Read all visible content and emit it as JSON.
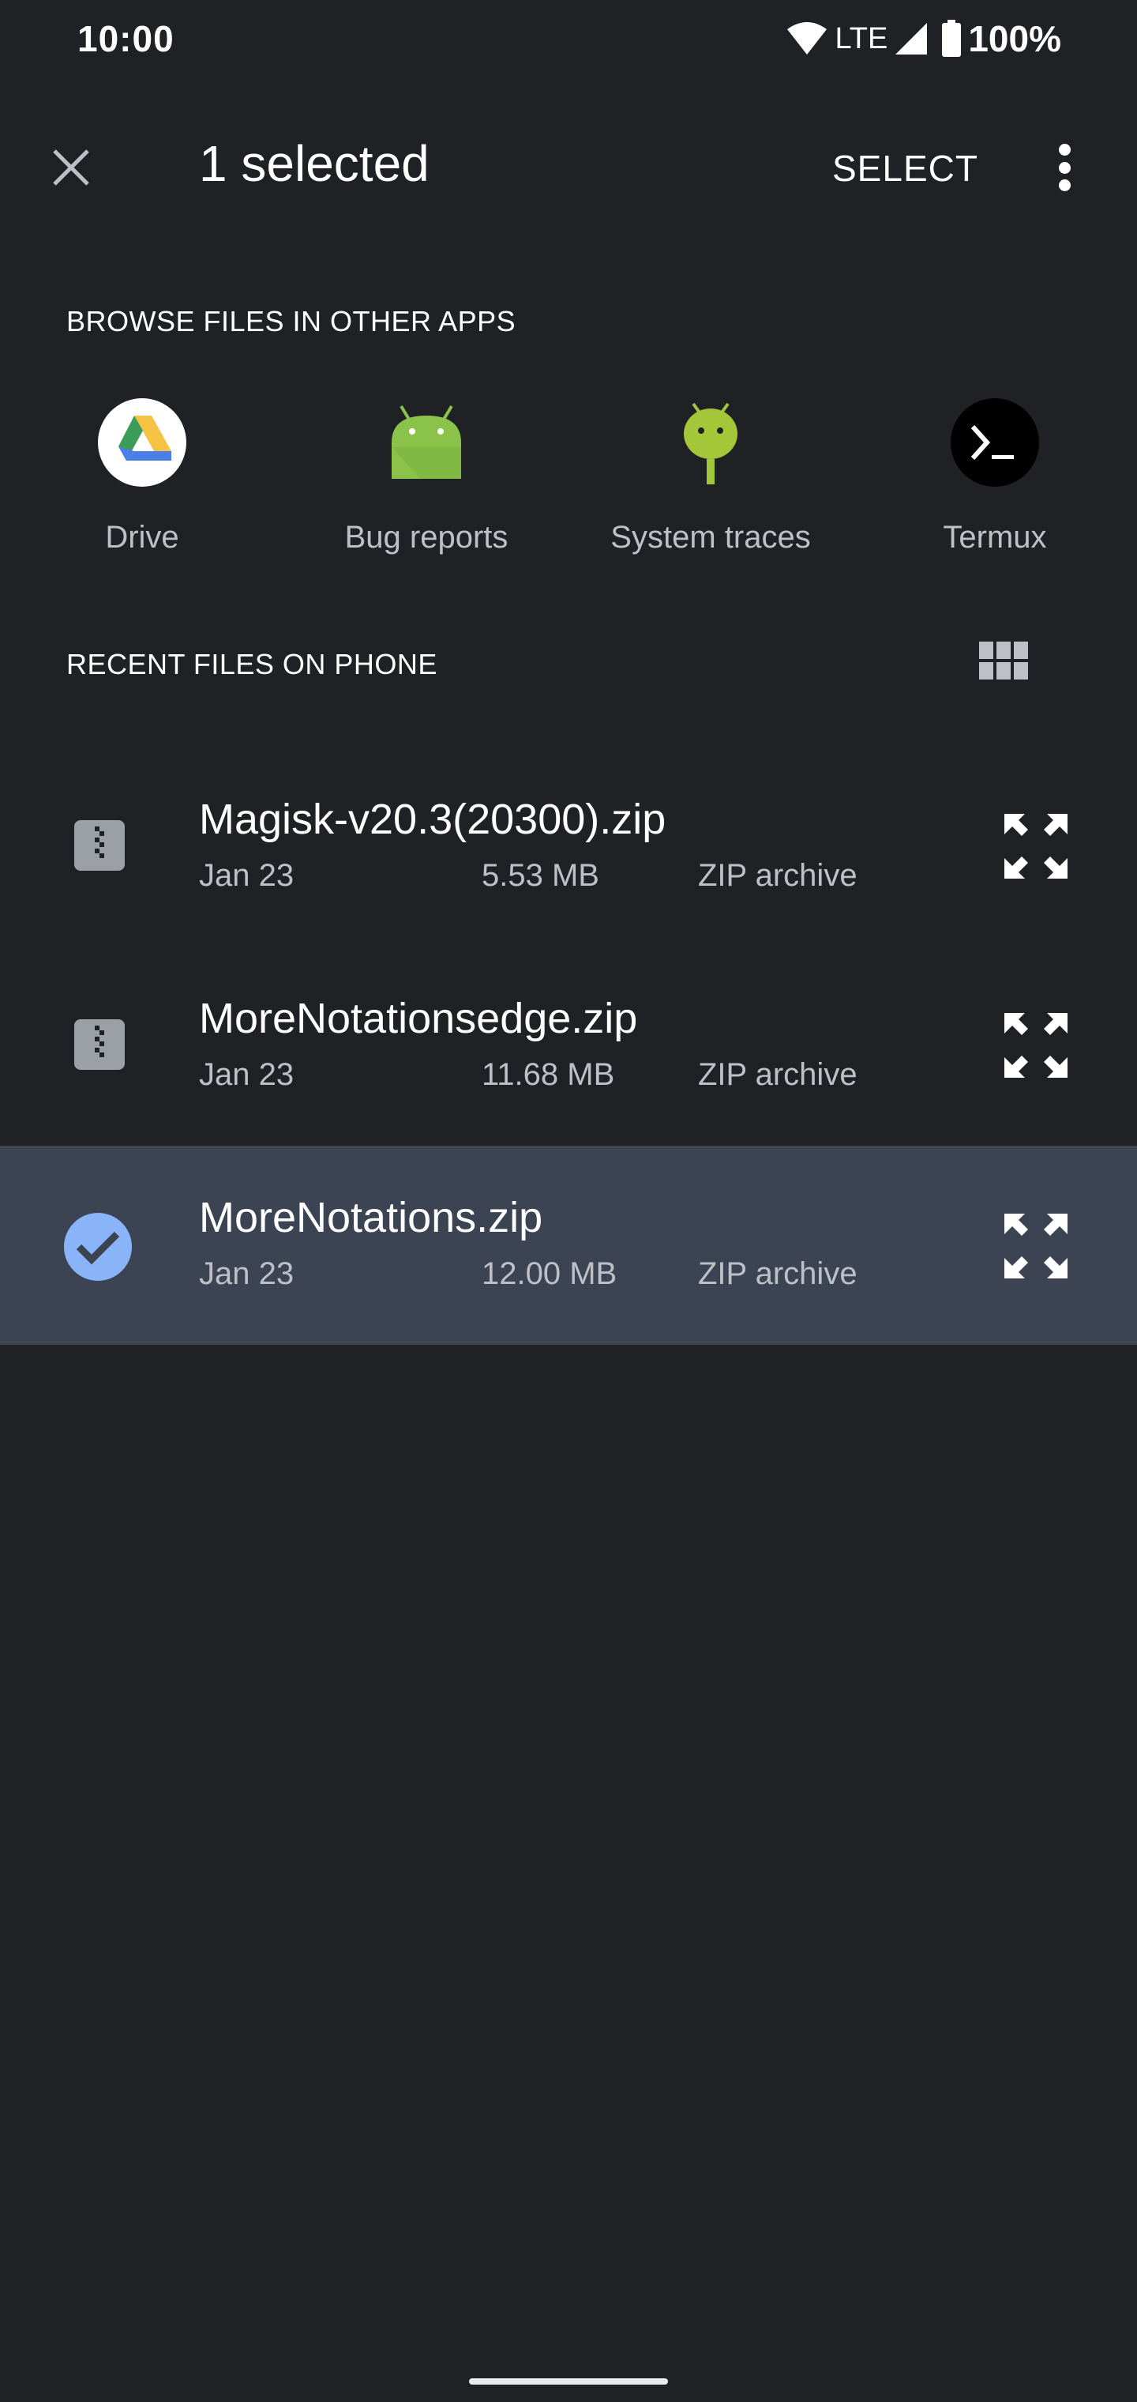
{
  "status_bar": {
    "time": "10:00",
    "network": "LTE",
    "battery": "100%",
    "icons": [
      "wifi-icon",
      "signal-icon",
      "battery-icon"
    ]
  },
  "app_bar": {
    "close_icon": "close-icon",
    "title": "1 selected",
    "select_label": "SELECT",
    "more_icon": "more-vert-icon"
  },
  "browse": {
    "header": "BROWSE FILES IN OTHER APPS",
    "apps": [
      {
        "label": "Drive",
        "icon": "google-drive-icon"
      },
      {
        "label": "Bug reports",
        "icon": "android-icon"
      },
      {
        "label": "System traces",
        "icon": "android-trace-icon"
      },
      {
        "label": "Termux",
        "icon": "terminal-icon"
      }
    ]
  },
  "recent": {
    "header": "RECENT FILES ON PHONE",
    "view_toggle_icon": "grid-view-icon",
    "files": [
      {
        "name": "Magisk-v20.3(20300).zip",
        "date": "Jan 23",
        "size": "5.53 MB",
        "type": "ZIP archive",
        "selected": false
      },
      {
        "name": "MoreNotationsedge.zip",
        "date": "Jan 23",
        "size": "11.68 MB",
        "type": "ZIP archive",
        "selected": false
      },
      {
        "name": "MoreNotations.zip",
        "date": "Jan 23",
        "size": "12.00 MB",
        "type": "ZIP archive",
        "selected": true
      }
    ]
  },
  "colors": {
    "background": "#202124",
    "selected_row": "#3c4453",
    "check_accent": "#8ab4f8",
    "secondary_text": "#bdc1c6"
  }
}
